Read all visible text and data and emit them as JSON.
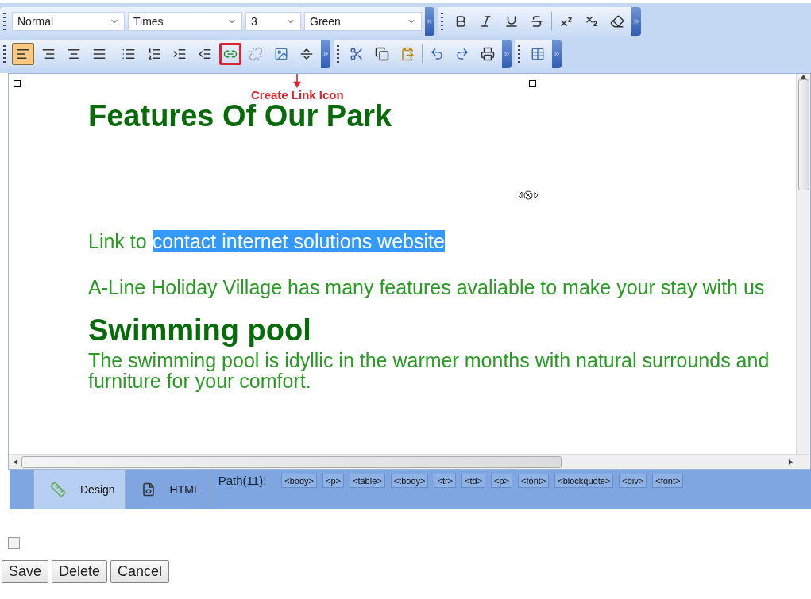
{
  "toolbar": {
    "dropdowns": [
      {
        "value": "Normal"
      },
      {
        "value": "Times"
      },
      {
        "value": "3"
      },
      {
        "value": "Green"
      }
    ],
    "alignment": [
      {
        "selected": true
      },
      {
        "selected": false
      },
      {
        "selected": false
      },
      {
        "selected": false
      }
    ],
    "link_button": {
      "highlighted": true
    }
  },
  "annotation": {
    "label": "Create Link Icon"
  },
  "content": [
    {
      "kind": "heading",
      "text": "Features Of Our Park"
    },
    {
      "kind": "marker"
    },
    {
      "kind": "link",
      "text": "Link to",
      "selected_text": "contact internet solutions website"
    },
    {
      "kind": "paragraph",
      "text": "A-Line Holiday Village has many features avaliable to make your stay with us"
    },
    {
      "kind": "heading",
      "text": "Swimming pool"
    },
    {
      "kind": "body",
      "text": "The swimming pool is idyllic in the warmer months with natural surrounds and furniture for your comfort."
    }
  ],
  "mode_tabs": [
    {
      "label": "Design",
      "selected": true
    },
    {
      "label": "HTML",
      "selected": false
    }
  ],
  "path": {
    "label": "Path(11):",
    "tags": [
      "<body>",
      "<p>",
      "<table>",
      "<tbody>",
      "<tr>",
      "<td>",
      "<p>",
      "<font>",
      "<blockquote>",
      "<div>",
      "<font>"
    ]
  },
  "checkbox": {
    "checked": false
  },
  "buttons": [
    "Save",
    "Delete",
    "Cancel"
  ]
}
